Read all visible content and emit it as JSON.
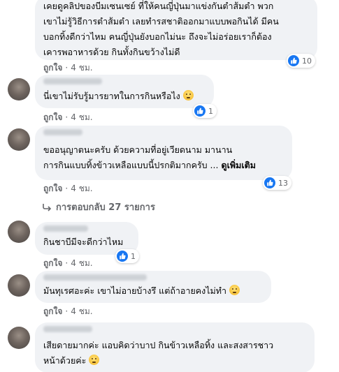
{
  "comments": [
    {
      "lines": [
        "เคยดูคลิปของบีมเซนเซย์ ที่ให้คนญี่ปุ่นมาแข่งกันตำส้มตำ พวก",
        "เขาไม่รู้วิธีการตำส้มตำ เลยทำรสชาติออกมาแบบพอกินได้ มีคน",
        "บอกทิ้งดีกว่าไหม คนญี่ปุ่นยังบอกไม่นะ ถึงจะไม่อร่อยเราก็ต้อง",
        "เคารพอาหารด้วย กินทั้งกินขว้างไม่ดี"
      ],
      "reactions": "10",
      "like_label": "ถูกใจ",
      "time": "4 ชม."
    },
    {
      "lines": [
        "นี่เขาไม่รับรู้มารยาทในการกินหรือไง"
      ],
      "reactions": "1",
      "like_label": "ถูกใจ",
      "time": "4 ชม."
    },
    {
      "lines": [
        "ขออนุญาตนะครับ ด้วยความที่อยู่เวียดนาม มานาน",
        "การกินแบบทิ้งข้าวเหลือแบบนี้ปรกติมากครับ ..."
      ],
      "see_more": "ดูเพิ่มเติม",
      "reactions": "13",
      "like_label": "ถูกใจ",
      "time": "4 ชม."
    },
    {
      "lines": [
        "กินชาบีมีจะดีกว่าไหม"
      ],
      "reactions": "1",
      "like_label": "ถูกใจ",
      "time": "4 ชม."
    },
    {
      "lines": [
        "มันทุเรศอะค่ะ เขาไม่อายบ้างรึ แต่ถ้าอายคงไม่ทำ"
      ],
      "like_label": "ถูกใจ",
      "time": "4 ชม."
    },
    {
      "lines": [
        "เสียดายมากค่ะ แอบคิดว่าบาป กินข้าวเหลือทิ้ง และสงสารชาว",
        "หน้าด้วยค่ะ"
      ]
    }
  ],
  "replies_toggle": "การตอบกลับ 27 รายการ",
  "colors": {
    "like_blue": "#1877f2",
    "bubble_bg": "#f0f2f5",
    "meta_text": "#65676b"
  }
}
